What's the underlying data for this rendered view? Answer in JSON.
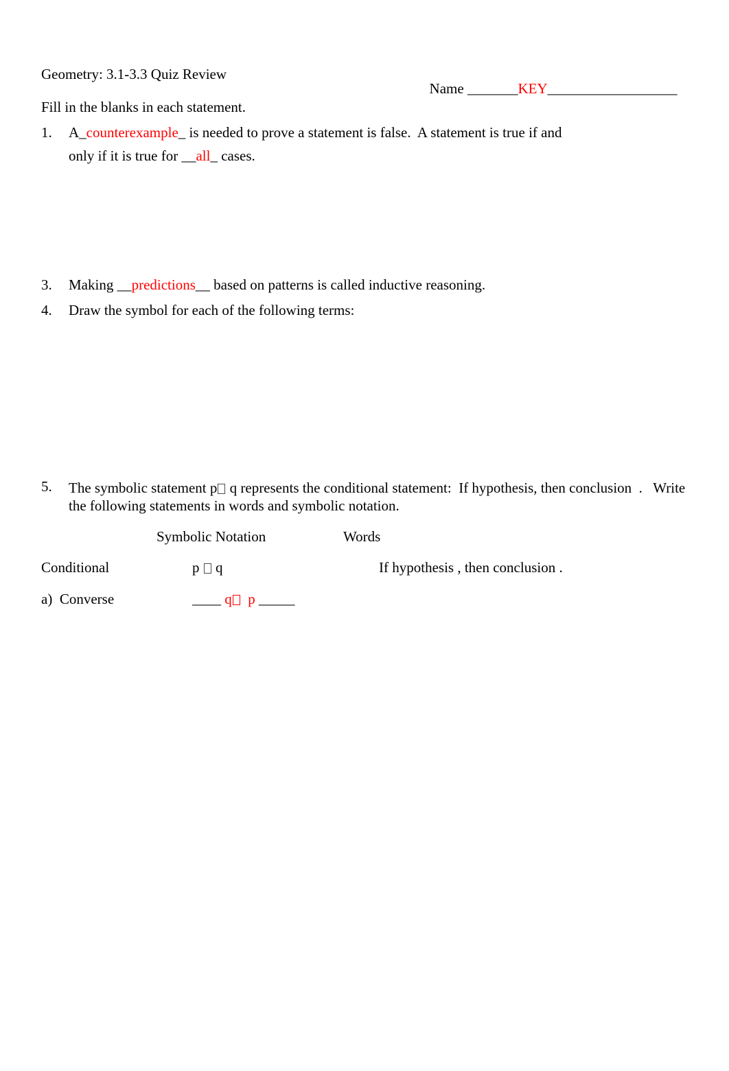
{
  "document": {
    "title": "Geometry: 3.1-3.3 Quiz Review",
    "name_label": "Name ",
    "name_blank_left": "_______",
    "name_answer": "KEY",
    "name_blank_right": "__________________",
    "instruction": "Fill in the blanks in each statement."
  },
  "items": {
    "item1": {
      "number": "1.",
      "line1_pre": "A",
      "line1_blank_open": "_",
      "line1_answer": "counterexample",
      "line1_blank_close": "_",
      "line1_post": " is needed to prove a statement is false.  A statement is true if and",
      "line2_pre": "only if it is true for ",
      "line2_blank_open": "__",
      "line2_answer": "all",
      "line2_blank_close": "_",
      "line2_post": " cases."
    },
    "item3": {
      "number": "3.",
      "pre": "Making ",
      "blank_open": "__",
      "answer": "predictions",
      "blank_close": "__",
      "post": " based on patterns is called inductive reasoning."
    },
    "item4": {
      "number": "4.",
      "text": "Draw the symbol for each of the following terms:"
    },
    "item5": {
      "number": "5.",
      "pre": "The symbolic statement p",
      "symbol_missing_glyph": "□",
      "mid": " q represents the conditional statement:  If hypothesis, then conclusion  .   Write",
      "line2": "the following statements in words and symbolic notation."
    }
  },
  "table": {
    "headers": {
      "row_label": "",
      "symbolic_notation": "Symbolic Notation",
      "words": "Words"
    },
    "rows": [
      {
        "label": "Conditional",
        "notation_pre": "p ",
        "notation_symbol": "□",
        "notation_post": " q",
        "words": "If hypothesis , then conclusion ."
      },
      {
        "label_marker": "a)",
        "label": "Converse",
        "notation_blank_open": "____ ",
        "notation_pre": "q",
        "notation_symbol": "□",
        "notation_mid": "  p",
        "notation_blank_close": " _____",
        "words": ""
      }
    ]
  },
  "colors": {
    "answer_red": "#ff0000",
    "text_black": "#000000",
    "page_background": "#ffffff"
  }
}
